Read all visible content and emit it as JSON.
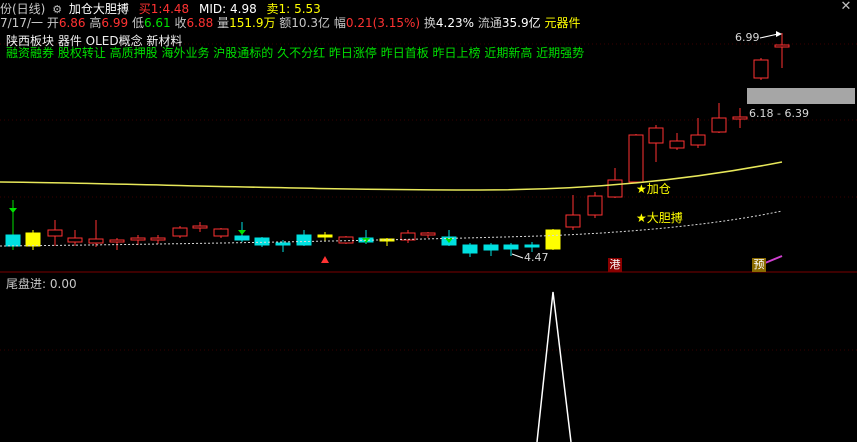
{
  "header": {
    "prefix": "份(日线)",
    "strategy": "加仓大胆搏",
    "buy1_label": "买1:",
    "buy1": "4.48",
    "mid_label": "MID:",
    "mid": "4.98",
    "sell1_label": "卖1:",
    "sell1": "5.53"
  },
  "quote": {
    "date": "7/17/一",
    "open_label": "开",
    "open": "6.86",
    "high_label": "高",
    "high": "6.99",
    "low_label": "低",
    "low": "6.61",
    "close_label": "收",
    "close": "6.88",
    "vol_label": "量",
    "vol": "151.9万",
    "amt_label": "额",
    "amt": "10.3亿",
    "chg_label": "幅",
    "chg": "0.21",
    "chg_pct": "(3.15%)",
    "turn_label": "换",
    "turn": "4.23%",
    "float_label": "流通",
    "float": "35.9亿",
    "tail": "元器件"
  },
  "concepts": {
    "line1": "陕西板块 器件 OLED概念 新材料",
    "line2": "融资融券 股权转让 高质押股 海外业务 沪股通标的 久不分红 昨日涨停 昨日首板 昨日上榜 近期新高 近期强势"
  },
  "annotations": {
    "price_high": "6.99",
    "price_range": "6.18 - 6.39",
    "price_low": "4.47",
    "signal_add": "★加仓",
    "signal_bold": "★大胆搏",
    "tag_gang": "港",
    "tag_yu": "预"
  },
  "indicator": {
    "label": "尾盘进:",
    "value": "0.00"
  },
  "colors": {
    "up": "#ff3232",
    "down": "#00e0e0",
    "yellow_candle": "#ffff00",
    "ma_line": "#e8e85a",
    "dotted": "#d8d8d8"
  }
}
